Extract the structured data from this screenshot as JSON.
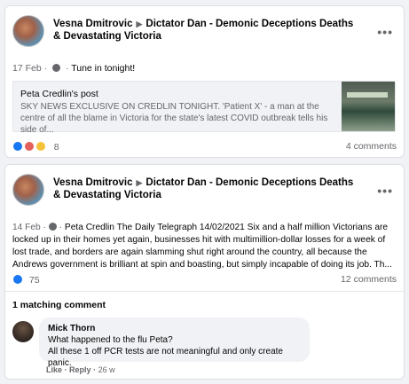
{
  "post1": {
    "author": "Vesna Dmitrovic",
    "group": "Dictator Dan - Demonic Deceptions Deaths & Devastating Victoria",
    "date": "17 Feb",
    "text": "Tune in tonight!",
    "shared": {
      "who": "Peta Credlin's post",
      "desc": "SKY NEWS EXCLUSIVE ON CREDLIN TONIGHT. 'Patient X' - a man at the centre of all the blame in Victoria for the state's latest COVID outbreak tells his side of..."
    },
    "reaction_count": "8",
    "comments": "4 comments"
  },
  "post2": {
    "author": "Vesna Dmitrovic",
    "group": "Dictator Dan - Demonic Deceptions Deaths & Devastating Victoria",
    "date": "14 Feb",
    "text": "Peta Credlin The Daily Telegraph 14/02/2021 Six and a half million Victorians are locked up in their homes yet again, businesses hit with multimillion-dollar losses for a week of lost trade, and borders are again slamming shut right around the country, all because the Andrews government is brilliant at spin and boasting, but simply incapable of doing its job. Th...",
    "reaction_count": "75",
    "comments": "12 comments",
    "matching": "1 matching comment",
    "comment": {
      "name": "Mick Thorn",
      "line1": "What happened to the flu Peta?",
      "line2": "All these 1 off PCR tests are not meaningful and only create panic.",
      "like": "Like",
      "reply": "Reply",
      "time": "26 w"
    }
  },
  "ui": {
    "more": "•••",
    "sep": "·"
  },
  "colors": {
    "accent": "#1877f2",
    "angry": "#e4605a",
    "sad": "#f5c33b"
  }
}
